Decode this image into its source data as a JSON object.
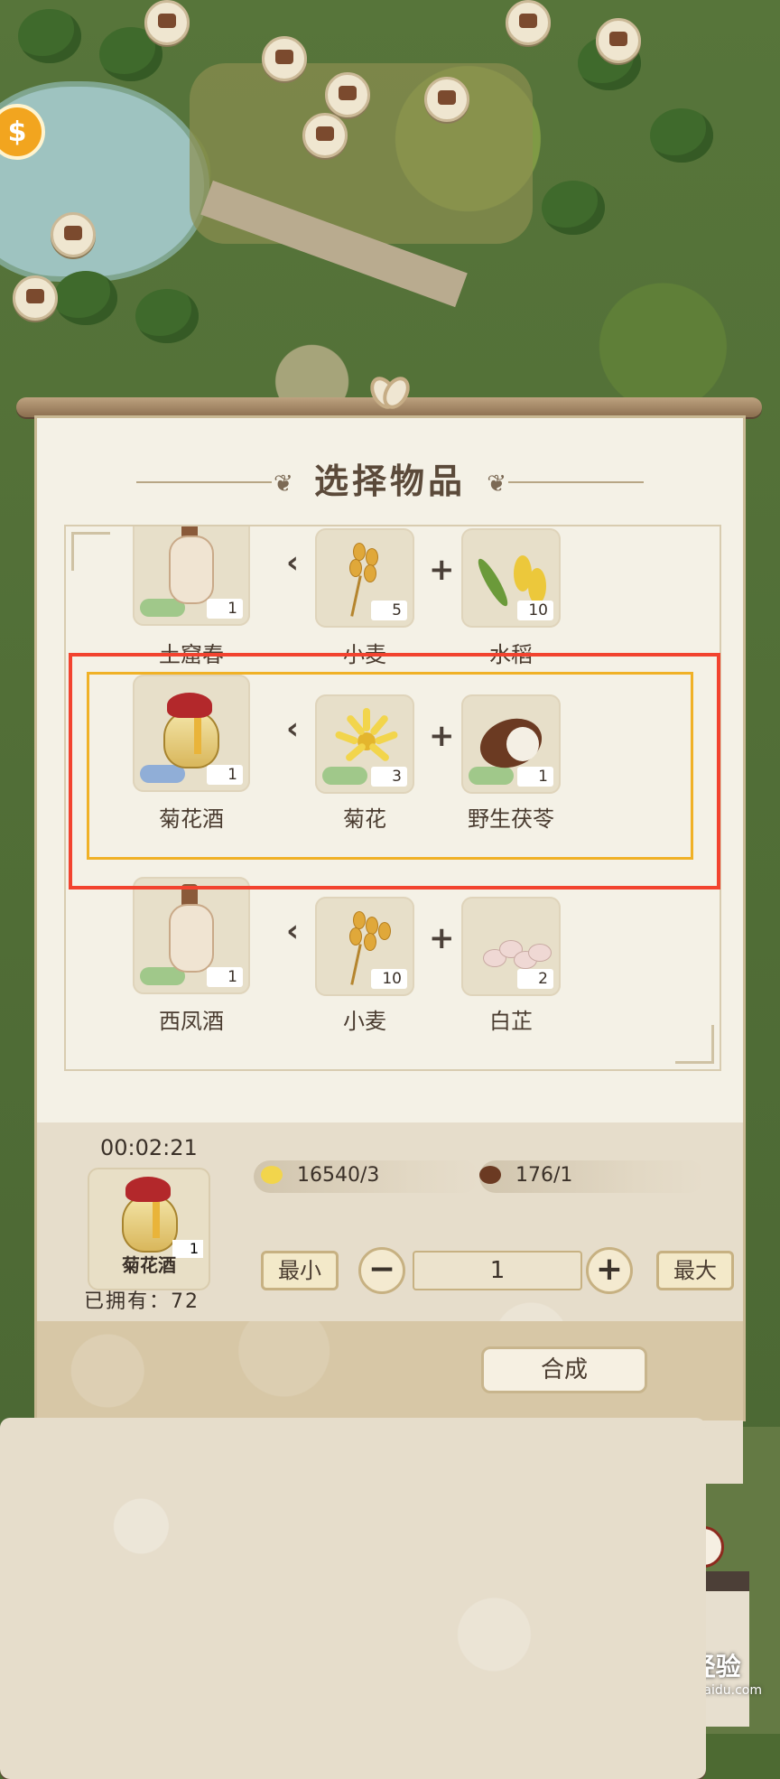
{
  "dialog": {
    "title": "选择物品"
  },
  "recipes": [
    {
      "product": {
        "name": "土窟春",
        "qty": "1"
      },
      "ingredients": [
        {
          "name": "小麦",
          "qty": "5"
        },
        {
          "name": "水稻",
          "qty": "10"
        }
      ]
    },
    {
      "product": {
        "name": "菊花酒",
        "qty": "1"
      },
      "ingredients": [
        {
          "name": "菊花",
          "qty": "3"
        },
        {
          "name": "野生茯苓",
          "qty": "1"
        }
      ]
    },
    {
      "product": {
        "name": "西凤酒",
        "qty": "1"
      },
      "ingredients": [
        {
          "name": "小麦",
          "qty": "10"
        },
        {
          "name": "白芷",
          "qty": "2"
        }
      ]
    }
  ],
  "craft": {
    "timer": "00:02:21",
    "item_name": "菊花酒",
    "item_qty": "1",
    "owned": "已拥有：72",
    "stock1": "16540/3",
    "stock2": "176/1",
    "min_label": "最小",
    "max_label": "最大",
    "quantity": "1",
    "synth_label": "合成"
  },
  "watermark": {
    "brand": "Bai经验",
    "site": "jingyan.baidu.com"
  },
  "colors": {
    "highlight": "#f2432f",
    "selection_frame": "#f0b126",
    "panel": "#f4f1e6"
  }
}
